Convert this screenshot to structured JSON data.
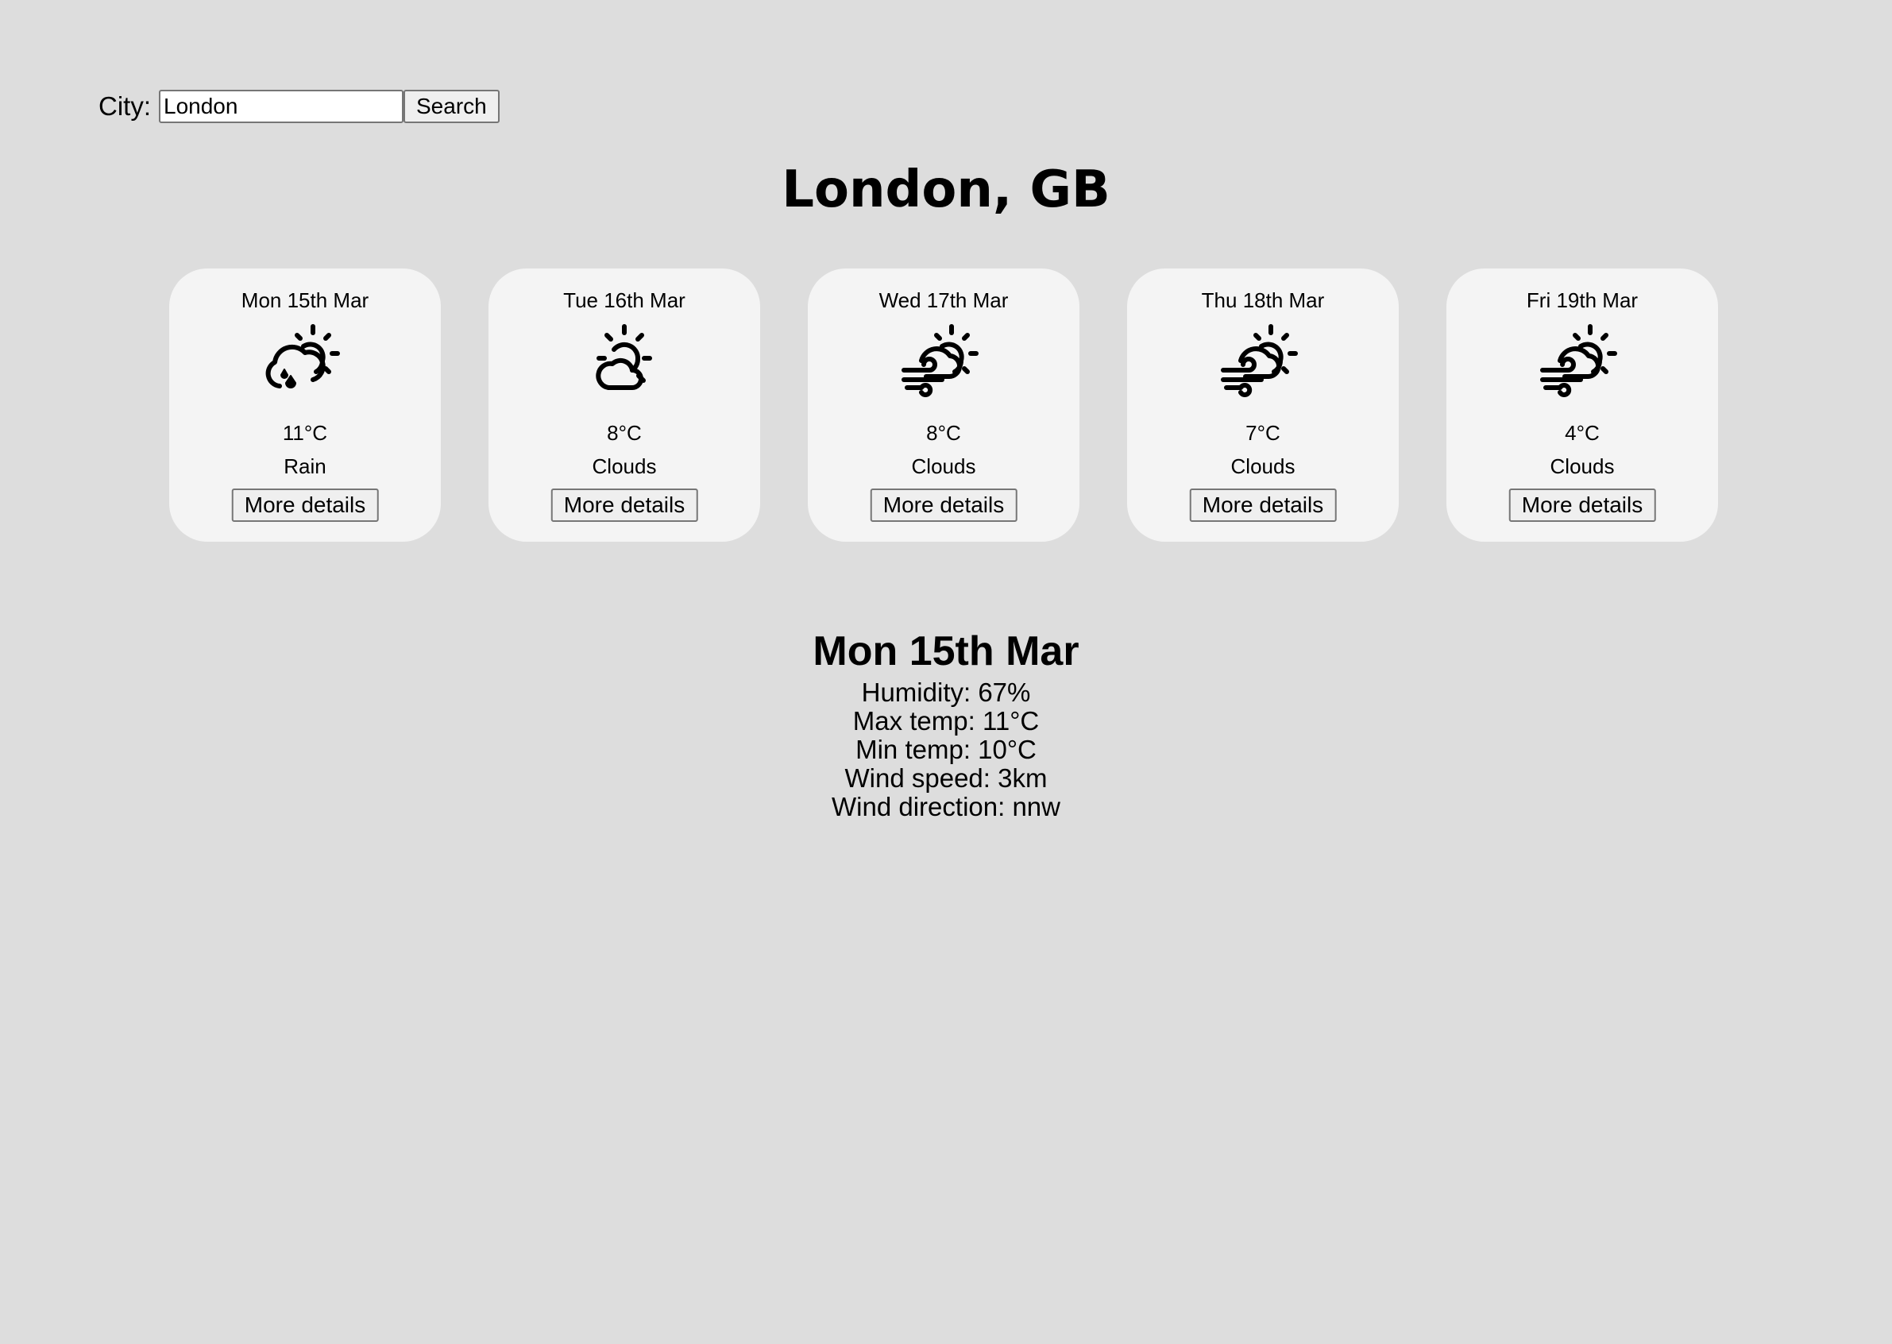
{
  "search": {
    "label": "City:",
    "value": "London",
    "button_label": "Search"
  },
  "location": {
    "title": "London, GB"
  },
  "forecast": [
    {
      "date": "Mon 15th Mar",
      "icon": "cloud-sun-rain-icon",
      "temp": "11°C",
      "condition": "Rain",
      "button_label": "More details"
    },
    {
      "date": "Tue 16th Mar",
      "icon": "sun-cloud-icon",
      "temp": "8°C",
      "condition": "Clouds",
      "button_label": "More details"
    },
    {
      "date": "Wed 17th Mar",
      "icon": "sun-cloud-wind-icon",
      "temp": "8°C",
      "condition": "Clouds",
      "button_label": "More details"
    },
    {
      "date": "Thu 18th Mar",
      "icon": "sun-cloud-wind-icon",
      "temp": "7°C",
      "condition": "Clouds",
      "button_label": "More details"
    },
    {
      "date": "Fri 19th Mar",
      "icon": "sun-cloud-wind-icon",
      "temp": "4°C",
      "condition": "Clouds",
      "button_label": "More details"
    }
  ],
  "details": {
    "date": "Mon 15th Mar",
    "humidity": "Humidity: 67%",
    "max_temp": "Max temp: 11°C",
    "min_temp": "Min temp: 10°C",
    "wind_speed": "Wind speed: 3km",
    "wind_direction": "Wind direction: nnw"
  },
  "colors": {
    "background": "#dddddd",
    "card_background": "#f4f4f4",
    "text": "#000000"
  }
}
